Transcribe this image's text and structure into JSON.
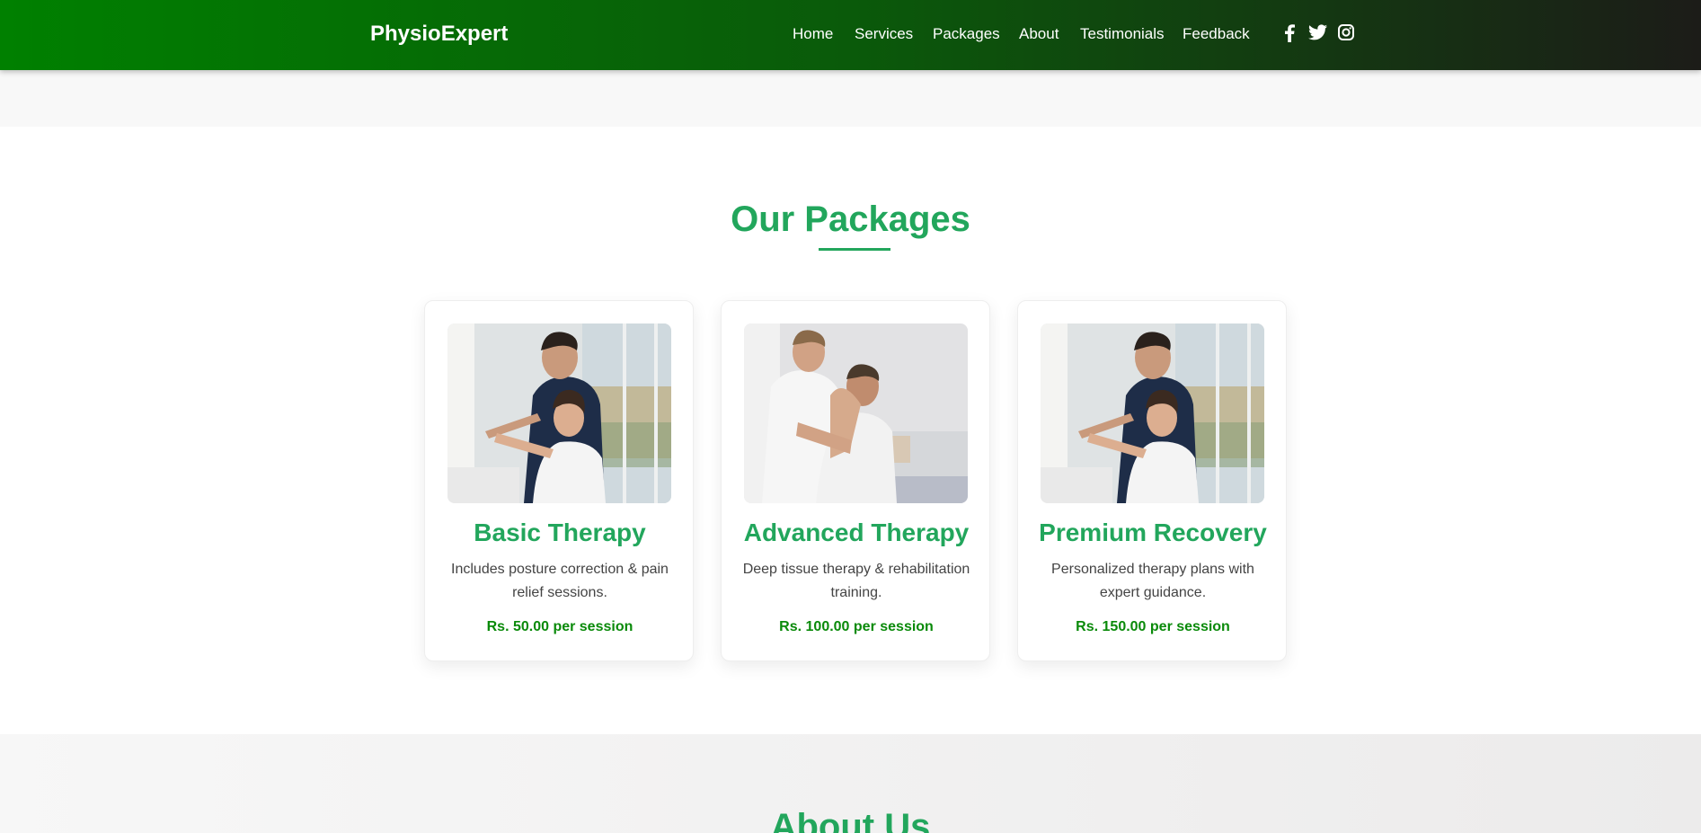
{
  "brand": "PhysioExpert",
  "nav": {
    "links": [
      "Home",
      "Services",
      "Packages",
      "About",
      "Testimonials",
      "Feedback"
    ]
  },
  "social": {
    "icons": [
      "facebook-icon",
      "twitter-icon",
      "instagram-icon"
    ]
  },
  "packages": {
    "title": "Our Packages",
    "cards": [
      {
        "title": "Basic Therapy",
        "description": "Includes posture correction & pain relief sessions.",
        "price": "Rs. 50.00 per session"
      },
      {
        "title": "Advanced Therapy",
        "description": "Deep tissue therapy & rehabilitation training.",
        "price": "Rs. 100.00 per session"
      },
      {
        "title": "Premium Recovery",
        "description": "Personalized therapy plans with expert guidance.",
        "price": "Rs. 150.00 per session"
      }
    ]
  },
  "about": {
    "title": "About Us"
  },
  "colors": {
    "accent": "#22a65c",
    "price": "#0a8a0a",
    "nav_gradient_start": "#008000",
    "nav_gradient_end": "#1c1c18"
  }
}
